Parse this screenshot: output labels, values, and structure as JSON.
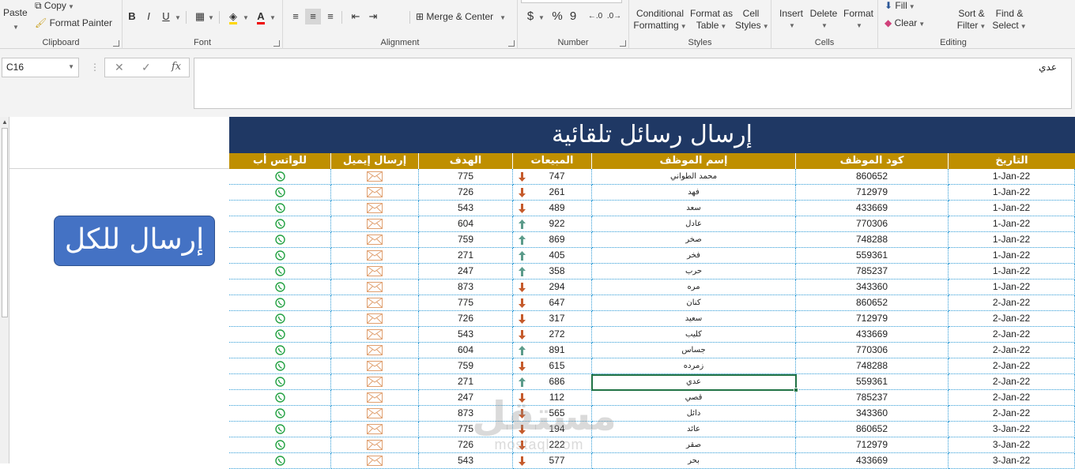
{
  "ribbon": {
    "clipboard": {
      "paste": "Paste",
      "copy": "Copy",
      "format_painter": "Format Painter",
      "label": "Clipboard"
    },
    "font": {
      "bold": "B",
      "italic": "I",
      "underline": "U",
      "label": "Font"
    },
    "alignment": {
      "merge_center": "Merge & Center",
      "label": "Alignment"
    },
    "number": {
      "currency": "$",
      "percent": "%",
      "comma": "9",
      "label": "Number"
    },
    "styles": {
      "conditional_1": "Conditional",
      "conditional_2": "Formatting",
      "format_table_1": "Format as",
      "format_table_2": "Table",
      "cell_styles_1": "Cell",
      "cell_styles_2": "Styles",
      "label": "Styles"
    },
    "cells": {
      "insert": "Insert",
      "delete": "Delete",
      "format": "Format",
      "label": "Cells"
    },
    "editing": {
      "fill": "Fill",
      "clear": "Clear",
      "sort_1": "Sort &",
      "sort_2": "Filter",
      "find_1": "Find &",
      "find_2": "Select",
      "label": "Editing"
    }
  },
  "formula_bar": {
    "name_box": "C16",
    "fx": "fx",
    "content": "عدي"
  },
  "send_all_button": "إرسال للكل",
  "sheet": {
    "title": "إرسال رسائل تلقائية",
    "headers": {
      "date": "التاريخ",
      "employee_code": "كود الموظف",
      "employee_name": "إسم الموظف",
      "sales": "المبيعات",
      "target": "الهدف",
      "send_email": "إرسال إيميل",
      "whatsapp": "للواتس أب"
    },
    "rows": [
      {
        "date": "1-Jan-22",
        "code": "860652",
        "name": "محمد الطواني",
        "sales": "747",
        "trend": "down",
        "target": "775"
      },
      {
        "date": "1-Jan-22",
        "code": "712979",
        "name": "فهد",
        "sales": "261",
        "trend": "down",
        "target": "726"
      },
      {
        "date": "1-Jan-22",
        "code": "433669",
        "name": "سعد",
        "sales": "489",
        "trend": "down",
        "target": "543"
      },
      {
        "date": "1-Jan-22",
        "code": "770306",
        "name": "عادل",
        "sales": "922",
        "trend": "up",
        "target": "604"
      },
      {
        "date": "1-Jan-22",
        "code": "748288",
        "name": "صخر",
        "sales": "869",
        "trend": "up",
        "target": "759"
      },
      {
        "date": "1-Jan-22",
        "code": "559361",
        "name": "فخر",
        "sales": "405",
        "trend": "up",
        "target": "271"
      },
      {
        "date": "1-Jan-22",
        "code": "785237",
        "name": "حرب",
        "sales": "358",
        "trend": "up",
        "target": "247"
      },
      {
        "date": "1-Jan-22",
        "code": "343360",
        "name": "مره",
        "sales": "294",
        "trend": "down",
        "target": "873"
      },
      {
        "date": "2-Jan-22",
        "code": "860652",
        "name": "كنان",
        "sales": "647",
        "trend": "down",
        "target": "775"
      },
      {
        "date": "2-Jan-22",
        "code": "712979",
        "name": "سعيد",
        "sales": "317",
        "trend": "down",
        "target": "726"
      },
      {
        "date": "2-Jan-22",
        "code": "433669",
        "name": "كليب",
        "sales": "272",
        "trend": "down",
        "target": "543"
      },
      {
        "date": "2-Jan-22",
        "code": "770306",
        "name": "جساس",
        "sales": "891",
        "trend": "up",
        "target": "604"
      },
      {
        "date": "2-Jan-22",
        "code": "748288",
        "name": "زمرده",
        "sales": "615",
        "trend": "down",
        "target": "759"
      },
      {
        "date": "2-Jan-22",
        "code": "559361",
        "name": "عدي",
        "sales": "686",
        "trend": "up",
        "target": "271"
      },
      {
        "date": "2-Jan-22",
        "code": "785237",
        "name": "قصي",
        "sales": "112",
        "trend": "down",
        "target": "247"
      },
      {
        "date": "2-Jan-22",
        "code": "343360",
        "name": "دائل",
        "sales": "565",
        "trend": "down",
        "target": "873"
      },
      {
        "date": "3-Jan-22",
        "code": "860652",
        "name": "عائد",
        "sales": "194",
        "trend": "down",
        "target": "775"
      },
      {
        "date": "3-Jan-22",
        "code": "712979",
        "name": "صقر",
        "sales": "222",
        "trend": "down",
        "target": "726"
      },
      {
        "date": "3-Jan-22",
        "code": "433669",
        "name": "بحر",
        "sales": "577",
        "trend": "down",
        "target": "543"
      }
    ]
  },
  "watermark": {
    "arabic": "مستقل",
    "latin": "mostaql.com"
  },
  "colors": {
    "title_bg": "#1f3864",
    "header_bg": "#bf8f00",
    "button_bg": "#4472c4",
    "up_arrow": "#5b9b8a",
    "down_arrow": "#c55a2b",
    "selection": "#217346",
    "grid_dotted": "#2e9bd6"
  }
}
